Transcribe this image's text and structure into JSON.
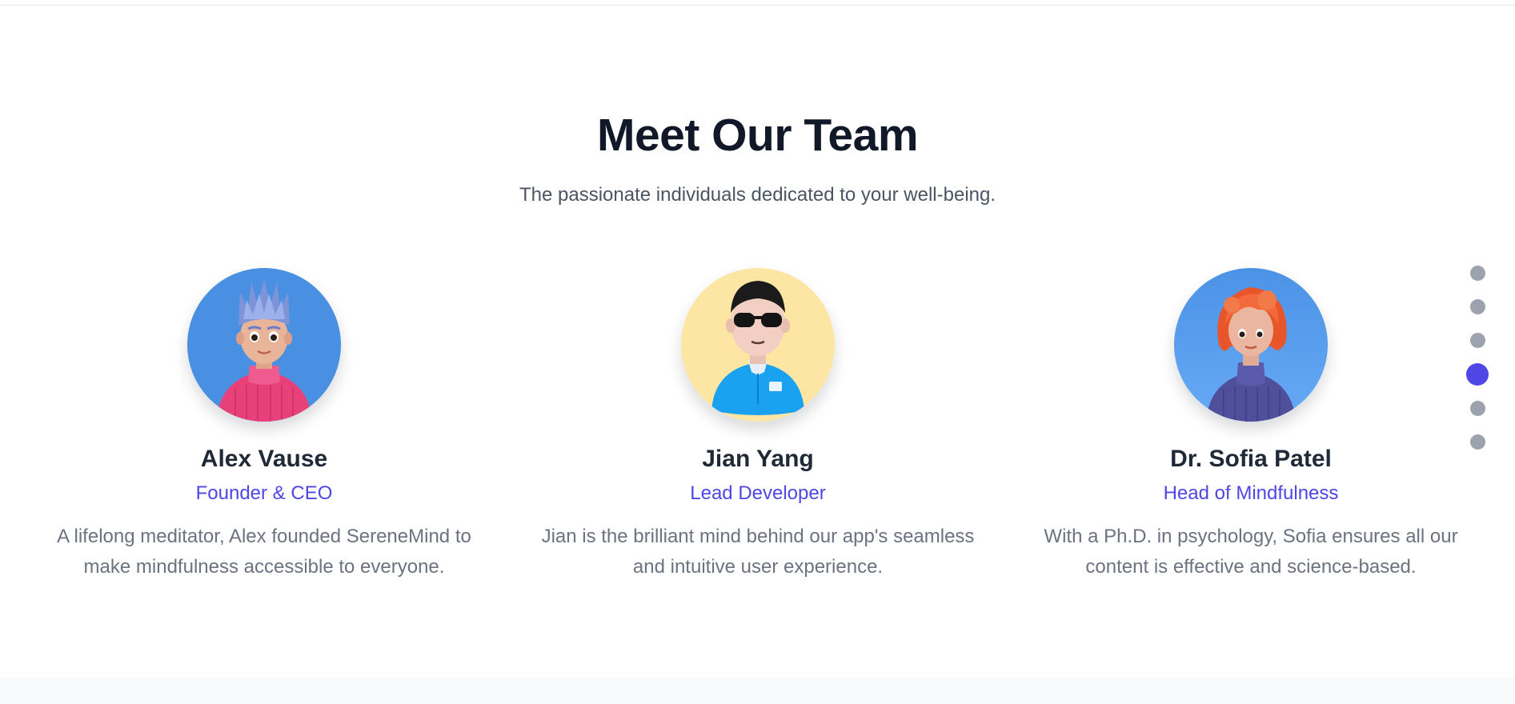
{
  "section": {
    "title": "Meet Our Team",
    "subtitle": "The passionate individuals dedicated to your well-being."
  },
  "team": [
    {
      "name": "Alex Vause",
      "role": "Founder & CEO",
      "bio": "A lifelong meditator, Alex founded SereneMind to make mindfulness accessible to everyone.",
      "avatar_icon": "avatar-blue-hair-pink-sweater",
      "avatar_bg": "#4a90e2"
    },
    {
      "name": "Jian Yang",
      "role": "Lead Developer",
      "bio": "Jian is the brilliant mind behind our app's seamless and intuitive user experience.",
      "avatar_icon": "avatar-sunglasses-blue-shirt",
      "avatar_bg": "#fde6a4"
    },
    {
      "name": "Dr. Sofia Patel",
      "role": "Head of Mindfulness",
      "bio": "With a Ph.D. in psychology, Sofia ensures all our content is effective and science-based.",
      "avatar_icon": "avatar-red-hair-purple-sweater",
      "avatar_bg": "#5aa0ef"
    }
  ],
  "pager": {
    "count": 6,
    "active_index": 3,
    "active_color": "#4f46e5",
    "inactive_color": "#9ca3af"
  },
  "colors": {
    "heading": "#111827",
    "accent": "#4f46e5",
    "body_text": "#6b7280"
  }
}
